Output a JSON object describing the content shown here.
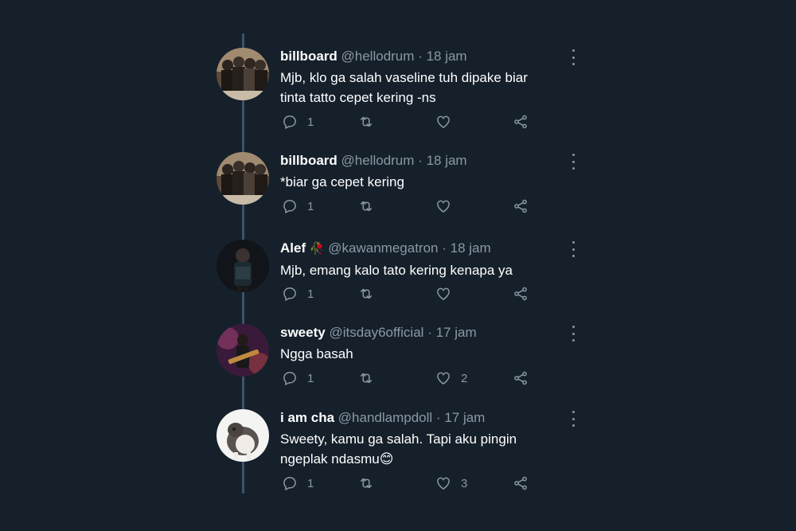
{
  "tweets": [
    {
      "name": "billboard",
      "handle": "@hellodrum",
      "dot": "·",
      "time": "18 jam",
      "text_lines": [
        "Mjb, klo ga salah vaseline tuh dipake biar",
        "tinta tatto cepet kering -ns"
      ],
      "replies": "1",
      "likes": "",
      "avatar_icon": "group-photo-avatar"
    },
    {
      "name": "billboard",
      "handle": "@hellodrum",
      "dot": "·",
      "time": "18 jam",
      "text_lines": [
        "*biar ga cepet kering"
      ],
      "replies": "1",
      "likes": "",
      "avatar_icon": "group-photo-avatar"
    },
    {
      "name": "Alef",
      "name_emoji": "🥀",
      "handle": "@kawanmegatron",
      "dot": "·",
      "time": "18 jam",
      "text_lines": [
        "Mjb, emang kalo tato kering kenapa ya"
      ],
      "replies": "1",
      "likes": "",
      "avatar_icon": "person-photo-avatar"
    },
    {
      "name": "sweety",
      "handle": "@itsday6official",
      "dot": "·",
      "time": "17 jam",
      "text_lines": [
        "Ngga basah"
      ],
      "replies": "1",
      "likes": "2",
      "avatar_icon": "guitarist-photo-avatar"
    },
    {
      "name": "i am cha",
      "handle": "@handlampdoll",
      "dot": "·",
      "time": "17 jam",
      "text_lines": [
        "Sweety, kamu ga salah. Tapi aku pingin",
        "ngeplak ndasmu😊"
      ],
      "replies": "1",
      "likes": "3",
      "avatar_icon": "cat-photo-avatar"
    }
  ],
  "colors": {
    "background": "#15202b",
    "secondary_text": "#8b98a5",
    "thread_line": "#3d5466"
  }
}
